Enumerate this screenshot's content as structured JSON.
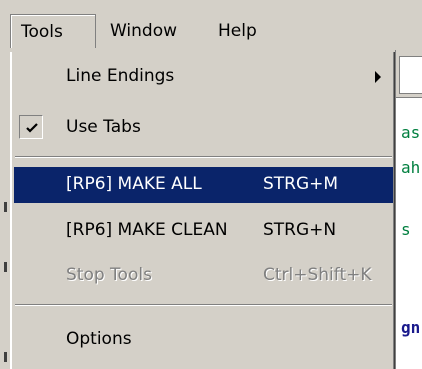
{
  "menubar": {
    "items": [
      "Tools",
      "Window",
      "Help"
    ]
  },
  "menu": {
    "line_endings": "Line Endings",
    "use_tabs": "Use Tabs",
    "make_all": "[RP6] MAKE ALL",
    "make_all_shortcut": "STRG+M",
    "make_clean": "[RP6] MAKE CLEAN",
    "make_clean_shortcut": "STRG+N",
    "stop_tools": "Stop Tools",
    "stop_tools_shortcut": "Ctrl+Shift+K",
    "options": "Options"
  },
  "editor": {
    "fragments": [
      "as",
      "ah",
      "s",
      "gn"
    ]
  },
  "colors": {
    "selection": "#0a246a",
    "menu_bg": "#d4d0c8",
    "code_green": "#007f3f",
    "code_navy": "#1a1a8c"
  }
}
